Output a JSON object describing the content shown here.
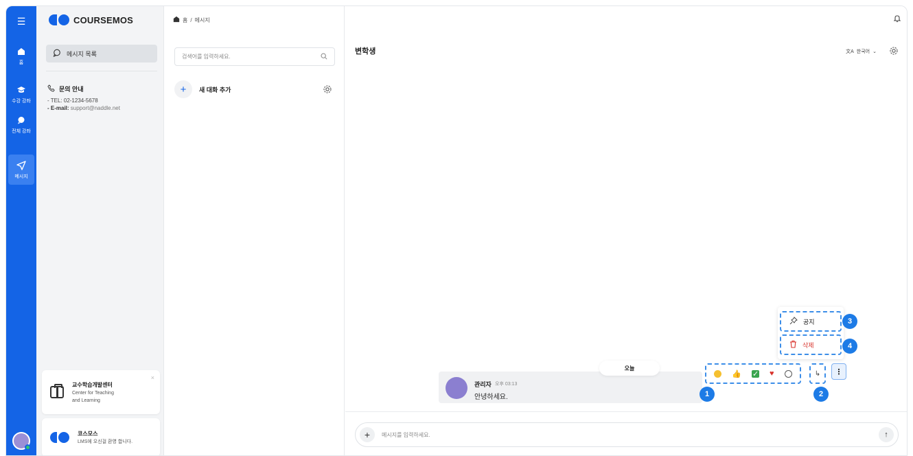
{
  "rail": {
    "items": [
      {
        "label": "홈"
      },
      {
        "label": "수강 강좌"
      },
      {
        "label": "전체 강좌"
      },
      {
        "label": "메시지"
      }
    ]
  },
  "side": {
    "brand": "COURSEMOS",
    "message_list": "메시지 목록",
    "contact": {
      "title": "문의 안내",
      "tel_label": "- TEL:",
      "tel": " 02-1234-5678",
      "email_label": "- E-mail:",
      "email": " support@naddle.net"
    },
    "promo1": {
      "title": "교수학습개발센터",
      "line1": "Center for Teaching",
      "line2": "and Learning",
      "close": "×"
    },
    "promo2": {
      "title": "코스모스",
      "line1": "LMS에 오신걸 환영 합니다."
    }
  },
  "convs": {
    "breadcrumb": [
      "홈",
      "/",
      "메시지"
    ],
    "search_placeholder": "검색어를 입력하세요.",
    "new_chat": "새 대화 추가"
  },
  "chat": {
    "title": "변학생",
    "language": "한국어",
    "today": "오늘",
    "message": {
      "sender": "관리자",
      "time": "오후 03:13",
      "text": "안녕하세요."
    },
    "menu": {
      "pin": "공지",
      "delete": "삭제"
    },
    "composer_placeholder": "메시지를 입력하세요.",
    "badges": [
      "1",
      "2",
      "3",
      "4"
    ]
  },
  "colors": {
    "primary": "#1464e6",
    "callout": "#1d7be6",
    "danger": "#d8322b"
  }
}
